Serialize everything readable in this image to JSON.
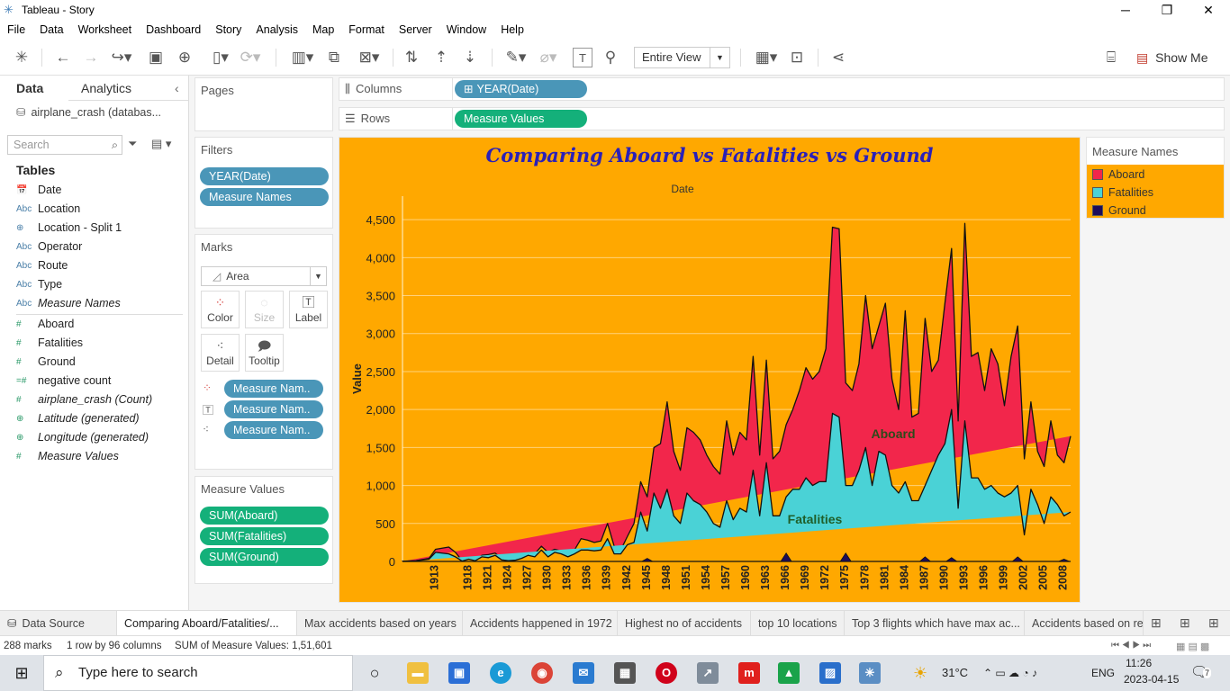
{
  "window": {
    "title": "Tableau - Story"
  },
  "menu": [
    "File",
    "Data",
    "Worksheet",
    "Dashboard",
    "Story",
    "Analysis",
    "Map",
    "Format",
    "Server",
    "Window",
    "Help"
  ],
  "toolbar": {
    "view_mode": "Entire View",
    "show_me": "Show Me"
  },
  "datapane": {
    "tabs": {
      "data": "Data",
      "analytics": "Analytics"
    },
    "datasource": "airplane_crash (databas...",
    "search_placeholder": "Search",
    "tables_heading": "Tables",
    "fields": [
      {
        "icon": "date",
        "name": "Date"
      },
      {
        "icon": "Abc",
        "name": "Location"
      },
      {
        "icon": "geo",
        "name": "Location - Split 1"
      },
      {
        "icon": "Abc",
        "name": "Operator"
      },
      {
        "icon": "Abc",
        "name": "Route"
      },
      {
        "icon": "Abc",
        "name": "Type"
      },
      {
        "icon": "Abc",
        "name": "Measure Names"
      },
      {
        "icon": "#",
        "name": "Aboard"
      },
      {
        "icon": "#",
        "name": "Fatalities"
      },
      {
        "icon": "#",
        "name": "Ground"
      },
      {
        "icon": "=#",
        "name": "negative count"
      },
      {
        "icon": "#",
        "name": "airplane_crash (Count)"
      },
      {
        "icon": "globe",
        "name": "Latitude (generated)"
      },
      {
        "icon": "globe",
        "name": "Longitude (generated)"
      },
      {
        "icon": "#",
        "name": "Measure Values"
      }
    ]
  },
  "shelves": {
    "pages": "Pages",
    "filters": "Filters",
    "filter_pills": [
      "YEAR(Date)",
      "Measure Names"
    ],
    "marks": "Marks",
    "mark_type": "Area",
    "mark_buttons": [
      "Color",
      "Size",
      "Label",
      "Detail",
      "Tooltip"
    ],
    "mark_pills": [
      "Measure Nam..",
      "Measure Nam..",
      "Measure Nam.."
    ],
    "measure_values": "Measure Values",
    "mv_pills": [
      "SUM(Aboard)",
      "SUM(Fatalities)",
      "SUM(Ground)"
    ],
    "columns": "Columns",
    "columns_pill": "YEAR(Date)",
    "rows": "Rows",
    "rows_pill": "Measure Values"
  },
  "legend": {
    "title": "Measure Names",
    "items": [
      {
        "name": "Aboard",
        "color": "#f2264b"
      },
      {
        "name": "Fatalities",
        "color": "#4ad2d6"
      },
      {
        "name": "Ground",
        "color": "#1d0c5a"
      }
    ]
  },
  "chart_data": {
    "type": "area",
    "title": "Comparing  Aboard vs  Fatalities vs Ground",
    "xlabel": "Date",
    "ylabel": "Value",
    "ylim": [
      0,
      4750
    ],
    "yticks": [
      0,
      500,
      1000,
      1500,
      2000,
      2500,
      3000,
      3500,
      4000,
      4500
    ],
    "ytick_labels": [
      "0",
      "500",
      "1,000",
      "1,500",
      "2,000",
      "2,500",
      "3,000",
      "3,500",
      "4,000",
      "4,500"
    ],
    "xtick_labels": [
      "1913",
      "1918",
      "1921",
      "1924",
      "1927",
      "1930",
      "1933",
      "1936",
      "1939",
      "1942",
      "1945",
      "1948",
      "1951",
      "1954",
      "1957",
      "1960",
      "1963",
      "1966",
      "1969",
      "1972",
      "1975",
      "1978",
      "1981",
      "1984",
      "1987",
      "1990",
      "1993",
      "1996",
      "1999",
      "2002",
      "2005",
      "2008"
    ],
    "background": "#ffa800",
    "annotations": [
      "Aboard",
      "Fatalities"
    ],
    "x": [
      1908,
      1910,
      1912,
      1913,
      1915,
      1916,
      1917,
      1918,
      1919,
      1920,
      1921,
      1922,
      1923,
      1924,
      1925,
      1926,
      1927,
      1928,
      1929,
      1930,
      1931,
      1932,
      1933,
      1934,
      1935,
      1936,
      1937,
      1938,
      1939,
      1940,
      1941,
      1942,
      1943,
      1944,
      1945,
      1946,
      1947,
      1948,
      1949,
      1950,
      1951,
      1952,
      1953,
      1954,
      1955,
      1956,
      1957,
      1958,
      1959,
      1960,
      1961,
      1962,
      1963,
      1964,
      1965,
      1966,
      1967,
      1968,
      1969,
      1970,
      1971,
      1972,
      1973,
      1974,
      1975,
      1976,
      1977,
      1978,
      1979,
      1980,
      1981,
      1982,
      1983,
      1984,
      1985,
      1986,
      1987,
      1988,
      1989,
      1990,
      1991,
      1992,
      1993,
      1994,
      1995,
      1996,
      1997,
      1998,
      1999,
      2000,
      2001,
      2002,
      2003,
      2004,
      2005,
      2006,
      2007,
      2008,
      2009
    ],
    "series": [
      {
        "name": "Aboard",
        "values": [
          2,
          10,
          40,
          160,
          190,
          120,
          10,
          40,
          20,
          80,
          90,
          110,
          40,
          20,
          25,
          60,
          100,
          100,
          200,
          120,
          160,
          140,
          120,
          150,
          300,
          280,
          250,
          270,
          500,
          200,
          150,
          330,
          500,
          1050,
          850,
          1500,
          1550,
          2100,
          1450,
          1200,
          1760,
          1700,
          1600,
          1400,
          1250,
          1150,
          1850,
          1400,
          1700,
          1600,
          2700,
          1400,
          2650,
          1350,
          1450,
          1800,
          2000,
          2250,
          2550,
          2400,
          2500,
          2800,
          4400,
          4380,
          2350,
          2250,
          2600,
          3500,
          2800,
          3100,
          3400,
          2400,
          2000,
          3300,
          1900,
          1950,
          3200,
          2500,
          2650,
          3400,
          4120,
          1850,
          4450,
          2700,
          2750,
          2250,
          2800,
          2600,
          2050,
          2700,
          3100,
          1350,
          2100,
          1450,
          1250,
          1850,
          1400,
          1300,
          1650,
          300
        ]
      },
      {
        "name": "Fatalities",
        "values": [
          1,
          8,
          30,
          120,
          100,
          60,
          5,
          30,
          10,
          60,
          50,
          80,
          20,
          10,
          15,
          40,
          80,
          60,
          150,
          60,
          120,
          100,
          60,
          100,
          150,
          150,
          140,
          150,
          300,
          100,
          100,
          220,
          250,
          650,
          400,
          900,
          700,
          950,
          600,
          500,
          900,
          800,
          750,
          650,
          500,
          450,
          800,
          550,
          700,
          650,
          1200,
          600,
          1300,
          600,
          600,
          850,
          950,
          950,
          1100,
          1000,
          1050,
          1050,
          1950,
          1900,
          1000,
          1000,
          1200,
          1500,
          1000,
          1450,
          1400,
          1000,
          900,
          1050,
          800,
          800,
          1000,
          1200,
          1400,
          1550,
          2000,
          700,
          1850,
          1100,
          1100,
          950,
          1000,
          900,
          850,
          900,
          1000,
          350,
          950,
          750,
          500,
          850,
          750,
          600,
          650,
          50
        ]
      },
      {
        "name": "Ground",
        "values": [
          0,
          0,
          0,
          0,
          0,
          0,
          0,
          0,
          0,
          0,
          0,
          0,
          0,
          0,
          0,
          0,
          0,
          0,
          0,
          0,
          0,
          0,
          0,
          0,
          0,
          0,
          0,
          0,
          0,
          0,
          0,
          0,
          0,
          0,
          0,
          0,
          0,
          0,
          0,
          0,
          0,
          0,
          0,
          0,
          0,
          0,
          0,
          0,
          0,
          0,
          0,
          0,
          0,
          0,
          0,
          0,
          0,
          0,
          0,
          0,
          0,
          0,
          0,
          0,
          0,
          0,
          0,
          0,
          0,
          0,
          0,
          0,
          0,
          0,
          0,
          0,
          0,
          0,
          0,
          0,
          0,
          0,
          0,
          0,
          0,
          0,
          0,
          0,
          0,
          0,
          0,
          0,
          0,
          0,
          0,
          0,
          0,
          0,
          0,
          0
        ]
      }
    ]
  },
  "sheet_tabs": [
    "Data Source",
    "Comparing Aboard/Fatalities/...",
    "Max accidents based on years",
    "Accidents happened in 1972",
    "Highest no of accidents",
    "top 10 locations",
    "Top 3 flights which have max ac...",
    "Accidents based on re"
  ],
  "status": {
    "marks": "288 marks",
    "layout": "1 row by 96 columns",
    "sum": "SUM of Measure Values: 1,51,601"
  },
  "taskbar": {
    "search_placeholder": "Type here to search",
    "temperature": "31°C",
    "lang": "ENG",
    "time": "11:26",
    "date": "2023-04-15",
    "notifications": "7"
  }
}
